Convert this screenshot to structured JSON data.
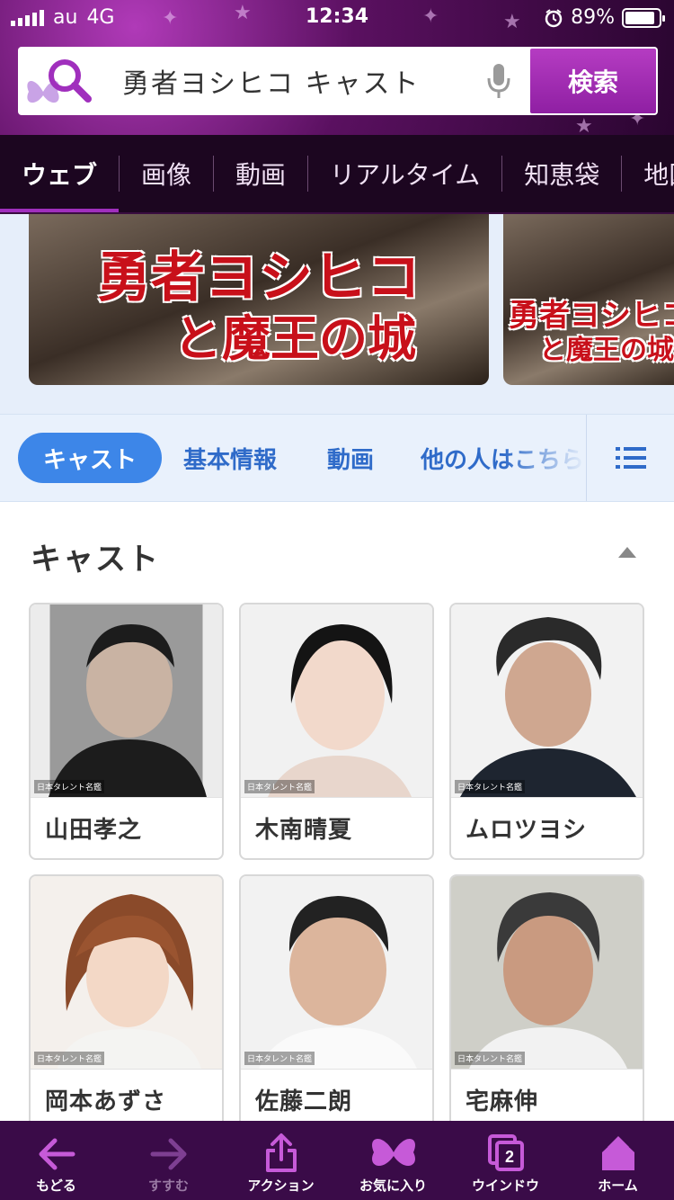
{
  "status_bar": {
    "carrier": "au",
    "network": "4G",
    "time": "12:34",
    "battery_percent": "89%",
    "battery_level": 0.89
  },
  "search": {
    "query": "勇者ヨシヒコ キャスト",
    "button_label": "検索"
  },
  "tabs": [
    {
      "label": "ウェブ",
      "active": true
    },
    {
      "label": "画像"
    },
    {
      "label": "動画"
    },
    {
      "label": "リアルタイム"
    },
    {
      "label": "知恵袋"
    },
    {
      "label": "地図"
    }
  ],
  "banner": {
    "poster1_title_line1": "勇者ヨシヒコ",
    "poster1_title_line2": "と魔王の城",
    "poster2_title_line1": "勇者ヨシヒコ",
    "poster2_title_line2": "と魔王の城"
  },
  "chips": [
    {
      "label": "キャスト",
      "active": true
    },
    {
      "label": "基本情報"
    },
    {
      "label": "動画"
    },
    {
      "label": "他の人はこちら"
    }
  ],
  "cast": {
    "title": "キャスト",
    "photo_credit": "日本タレント名鑑",
    "members": [
      {
        "name": "山田孝之"
      },
      {
        "name": "木南晴夏"
      },
      {
        "name": "ムロツヨシ"
      },
      {
        "name": "岡本あずさ"
      },
      {
        "name": "佐藤二朗"
      },
      {
        "name": "宅麻伸"
      }
    ]
  },
  "toolbar": {
    "back": "もどる",
    "forward": "すすむ",
    "action": "アクション",
    "favorites": "お気に入り",
    "window": "ウインドウ",
    "window_count": "2",
    "home": "ホーム"
  },
  "colors": {
    "brand_purple": "#8f1fa3",
    "chip_blue": "#3d86e8",
    "link_blue": "#2f6bc9"
  }
}
